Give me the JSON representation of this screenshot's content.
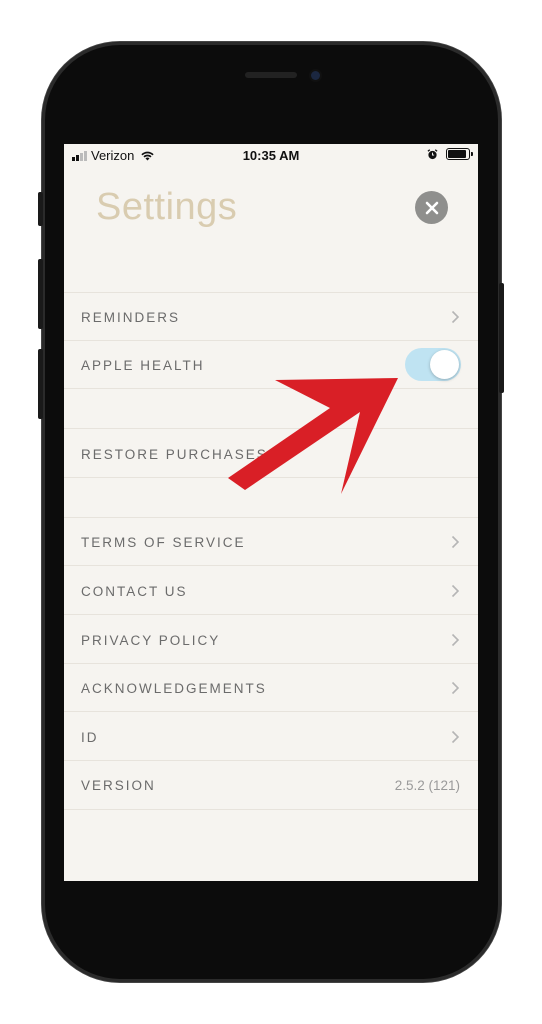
{
  "status_bar": {
    "carrier": "Verizon",
    "time": "10:35 AM"
  },
  "settings": {
    "title": "Settings",
    "items": [
      {
        "label": "REMINDERS",
        "type": "chevron"
      },
      {
        "label": "APPLE HEALTH",
        "type": "toggle",
        "on": true
      },
      {
        "label": "RESTORE PURCHASES",
        "type": "plain"
      },
      {
        "label": "TERMS OF SERVICE",
        "type": "chevron"
      },
      {
        "label": "CONTACT US",
        "type": "chevron"
      },
      {
        "label": "PRIVACY POLICY",
        "type": "chevron"
      },
      {
        "label": "ACKNOWLEDGEMENTS",
        "type": "chevron"
      },
      {
        "label": "ID",
        "type": "chevron"
      },
      {
        "label": "VERSION",
        "type": "value",
        "value": "2.5.2 (121)"
      }
    ]
  },
  "colors": {
    "title": "#d9ccb0",
    "toggle_on": "#bfe3f2",
    "annotation_arrow": "#d91f26"
  },
  "icons": [
    "wifi-icon",
    "alarm-icon",
    "battery-icon",
    "close-icon",
    "chevron-right-icon",
    "annotation-arrow"
  ]
}
